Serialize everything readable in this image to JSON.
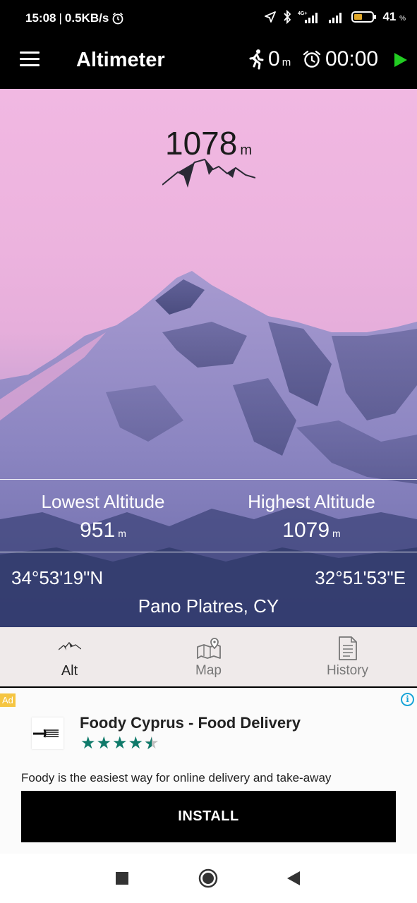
{
  "status": {
    "time": "15:08",
    "net_speed": "0.5KB/s",
    "battery": "41",
    "battery_unit": "%"
  },
  "app_bar": {
    "title": "Altimeter",
    "distance_value": "0",
    "distance_unit": "m",
    "timer": "00:00"
  },
  "altitude": {
    "current": "1078",
    "unit": "m"
  },
  "stats": {
    "lowest_label": "Lowest Altitude",
    "lowest_value": "951",
    "highest_label": "Highest Altitude",
    "highest_value": "1079",
    "unit": "m"
  },
  "location": {
    "latitude": "34°53'19\"N",
    "longitude": "32°51'53\"E",
    "place": "Pano Platres, CY"
  },
  "tabs": [
    {
      "label": "Alt",
      "icon": "mountain-icon",
      "active": true
    },
    {
      "label": "Map",
      "icon": "map-pin-icon",
      "active": false
    },
    {
      "label": "History",
      "icon": "document-icon",
      "active": false
    }
  ],
  "ad": {
    "badge": "Ad",
    "info": "i",
    "title": "Foody Cyprus - Food Delivery",
    "rating": 4.5,
    "description": "Foody is the easiest way for online delivery and take-away",
    "install_label": "INSTALL",
    "star_color": "#0f7a6a"
  },
  "colors": {
    "play_green": "#22cc22",
    "sky_pink": "#f1b8e2"
  }
}
